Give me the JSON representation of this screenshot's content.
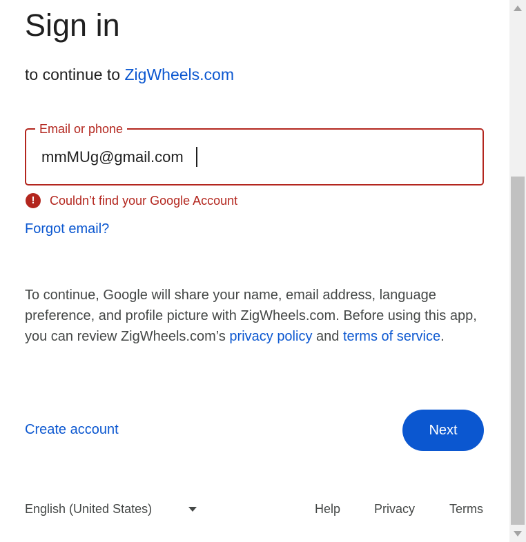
{
  "header": {
    "title": "Sign in",
    "subtitle_prefix": "to continue to ",
    "app_name": "ZigWheels.com"
  },
  "email_field": {
    "label": "Email or phone",
    "value": "mmMUg@gmail.com"
  },
  "error": {
    "icon": "!",
    "message": "Couldn’t find your Google Account"
  },
  "forgot_email": "Forgot email?",
  "consent": {
    "text_1": "To continue, Google will share your name, email address, language preference, and profile picture with ZigWheels.com. Before using this app, you can review ZigWheels.com’s ",
    "privacy_link": "privacy policy",
    "text_2": " and ",
    "terms_link": "terms of service",
    "text_3": "."
  },
  "actions": {
    "create_account": "Create account",
    "next": "Next"
  },
  "footer": {
    "language": "English (United States)",
    "help": "Help",
    "privacy": "Privacy",
    "terms": "Terms"
  },
  "colors": {
    "accent": "#0b57d0",
    "error": "#b3261e",
    "text": "#1f1f1f",
    "muted": "#444746"
  },
  "icons": {
    "error": "error-icon",
    "language_dropdown": "caret-down-icon",
    "scroll_up": "scroll-up-arrow-icon",
    "scroll_down": "scroll-down-arrow-icon"
  }
}
